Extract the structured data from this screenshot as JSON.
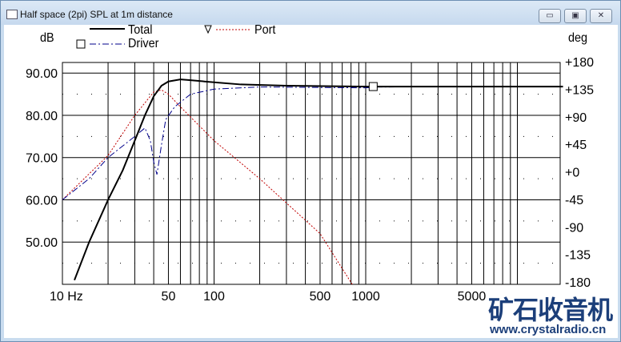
{
  "window": {
    "title": "Half space (2pi) SPL at 1m distance",
    "minimize": "▭",
    "maximize": "▣",
    "close": "✕"
  },
  "legend": {
    "total": "Total",
    "driver": "Driver",
    "port": "Port"
  },
  "watermark": {
    "cn": "矿石收音机",
    "url": "www.crystalradio.cn"
  },
  "chart_data": {
    "type": "line",
    "title": "Half space (2pi) SPL at 1m distance",
    "ylabel": "dB",
    "y2label": "deg",
    "xlabel": "Hz",
    "xscale": "log",
    "xlim": [
      10,
      20000
    ],
    "ylim": [
      40,
      92.5
    ],
    "y2lim": [
      -180,
      180
    ],
    "xticks": [
      {
        "v": 10,
        "t": "10 Hz"
      },
      {
        "v": 50,
        "t": "50"
      },
      {
        "v": 100,
        "t": "100"
      },
      {
        "v": 500,
        "t": "500"
      },
      {
        "v": 1000,
        "t": "1000"
      },
      {
        "v": 5000,
        "t": "5000"
      }
    ],
    "yticks": [
      {
        "v": 90,
        "t": "90.00"
      },
      {
        "v": 80,
        "t": "80.00"
      },
      {
        "v": 70,
        "t": "70.00"
      },
      {
        "v": 60,
        "t": "60.00"
      },
      {
        "v": 50,
        "t": "50.00"
      }
    ],
    "y2ticks": [
      {
        "v": 180,
        "t": "+180"
      },
      {
        "v": 135,
        "t": "+135"
      },
      {
        "v": 90,
        "t": "+90"
      },
      {
        "v": 45,
        "t": "+45"
      },
      {
        "v": 0,
        "t": "+0"
      },
      {
        "v": -45,
        "t": "-45"
      },
      {
        "v": -90,
        "t": "-90"
      },
      {
        "v": -135,
        "t": "-135"
      },
      {
        "v": -180,
        "t": "-180"
      }
    ],
    "series": [
      {
        "name": "Total",
        "color": "#000000",
        "style": "solid",
        "x": [
          12,
          15,
          20,
          25,
          30,
          35,
          40,
          45,
          50,
          60,
          70,
          100,
          150,
          300,
          1000,
          20000
        ],
        "y": [
          41,
          50,
          60,
          67,
          74,
          80,
          84.5,
          87,
          88,
          88.5,
          88.3,
          87.8,
          87.3,
          87,
          86.8,
          86.8
        ]
      },
      {
        "name": "Driver",
        "color": "#00008b",
        "style": "dashdot",
        "x": [
          10,
          15,
          20,
          30,
          35,
          38,
          40,
          42,
          45,
          48,
          55,
          70,
          100,
          200,
          1000,
          1200,
          20000
        ],
        "y": [
          60,
          65,
          70,
          75,
          77,
          74,
          69,
          66,
          73,
          79,
          82,
          85,
          86.2,
          86.7,
          86.5,
          86.7,
          86.8
        ]
      },
      {
        "name": "Port",
        "color": "#c00000",
        "style": "dotted",
        "x": [
          10,
          20,
          30,
          40,
          45,
          50,
          60,
          100,
          200,
          500,
          815
        ],
        "y": [
          60,
          70.5,
          80,
          85.5,
          86,
          85,
          82,
          74,
          65,
          52,
          40
        ]
      }
    ],
    "markers": [
      {
        "series": "Driver",
        "shape": "square",
        "x": 1120,
        "y": 86.8
      }
    ]
  }
}
